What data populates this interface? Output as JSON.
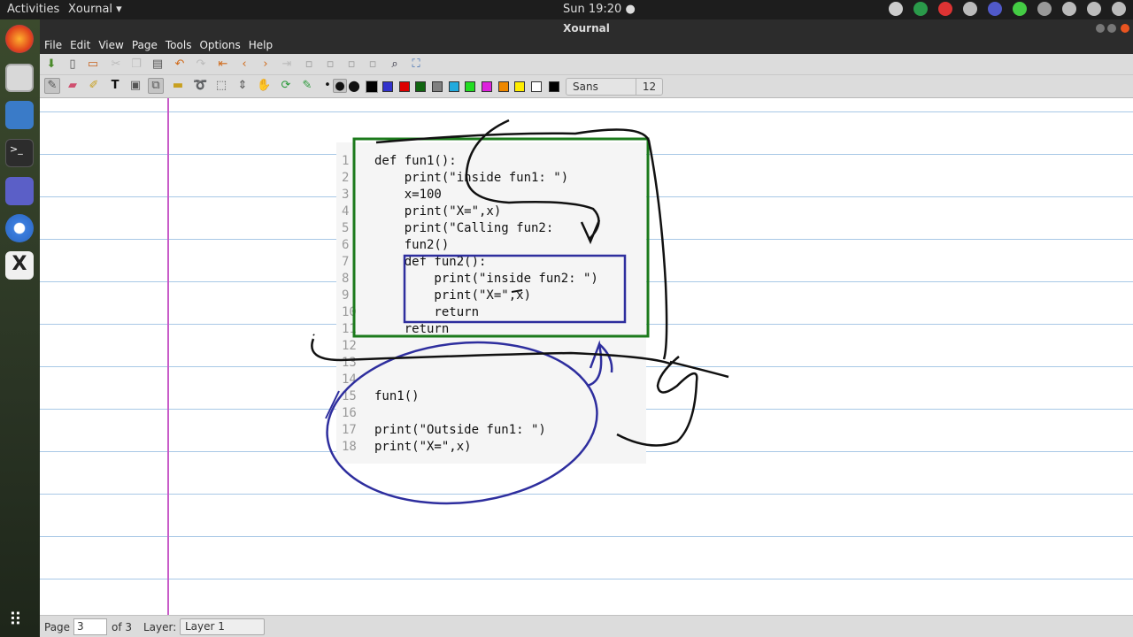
{
  "system_bar": {
    "activities": "Activities",
    "app_menu": "Xournal ▾",
    "clock": "Sun 19:20 ●"
  },
  "window": {
    "title": "Xournal"
  },
  "menu": [
    "File",
    "Edit",
    "View",
    "Page",
    "Tools",
    "Options",
    "Help"
  ],
  "toolbar": {
    "font_name": "Sans",
    "font_size": "12",
    "colors": [
      "#000000",
      "#3333cc",
      "#dd0000",
      "#116611",
      "#808080",
      "#22aadd",
      "#22dd22",
      "#dd22dd",
      "#ee8800",
      "#ffee00",
      "#ffffff",
      "#000000"
    ]
  },
  "code": [
    {
      "n": "1",
      "t": "def fun1():"
    },
    {
      "n": "2",
      "t": "    print(\"inside fun1: \")"
    },
    {
      "n": "3",
      "t": "    x=100"
    },
    {
      "n": "4",
      "t": "    print(\"X=\",x)"
    },
    {
      "n": "5",
      "t": "    print(\"Calling fun2:"
    },
    {
      "n": "6",
      "t": "    fun2()"
    },
    {
      "n": "7",
      "t": "    def fun2():"
    },
    {
      "n": "8",
      "t": "        print(\"inside fun2: \")"
    },
    {
      "n": "9",
      "t": "        print(\"X=\",x)"
    },
    {
      "n": "10",
      "t": "        return"
    },
    {
      "n": "11",
      "t": "    return"
    },
    {
      "n": "12",
      "t": ""
    },
    {
      "n": "13",
      "t": ""
    },
    {
      "n": "14",
      "t": ""
    },
    {
      "n": "15",
      "t": "fun1()"
    },
    {
      "n": "16",
      "t": ""
    },
    {
      "n": "17",
      "t": "print(\"Outside fun1: \")"
    },
    {
      "n": "18",
      "t": "print(\"X=\",x)"
    }
  ],
  "status": {
    "page_label": "Page",
    "page_value": "3",
    "page_of": "of 3",
    "layer_label": "Layer:",
    "layer_value": "Layer 1"
  }
}
